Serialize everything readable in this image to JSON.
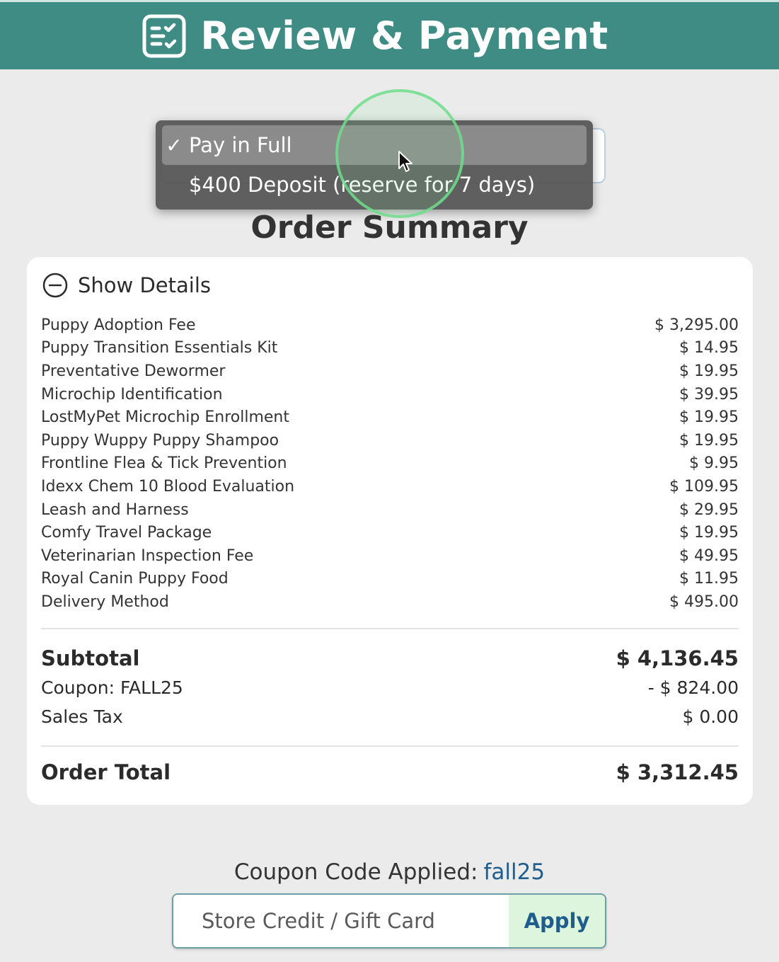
{
  "header": {
    "title": "Review & Payment",
    "icon": "checklist-icon"
  },
  "payment_dropdown": {
    "options": [
      {
        "label": "Pay in Full",
        "selected": true
      },
      {
        "label": "$400 Deposit (reserve for 7 days)",
        "selected": false
      }
    ],
    "check_mark": "✓"
  },
  "summary": {
    "title": "Order Summary",
    "toggle_label": "Show Details",
    "items": [
      {
        "name": "Puppy Adoption Fee",
        "price": "$ 3,295.00"
      },
      {
        "name": "Puppy Transition Essentials Kit",
        "price": "$ 14.95"
      },
      {
        "name": "Preventative Dewormer",
        "price": "$ 19.95"
      },
      {
        "name": "Microchip Identification",
        "price": "$ 39.95"
      },
      {
        "name": "LostMyPet Microchip Enrollment",
        "price": "$ 19.95"
      },
      {
        "name": "Puppy Wuppy Puppy Shampoo",
        "price": "$ 19.95"
      },
      {
        "name": "Frontline Flea & Tick Prevention",
        "price": "$ 9.95"
      },
      {
        "name": "Idexx Chem 10 Blood Evaluation",
        "price": "$ 109.95"
      },
      {
        "name": "Leash and Harness",
        "price": "$ 29.95"
      },
      {
        "name": "Comfy Travel Package",
        "price": "$ 19.95"
      },
      {
        "name": "Veterinarian Inspection Fee",
        "price": "$ 49.95"
      },
      {
        "name": "Royal Canin Puppy Food",
        "price": "$ 11.95"
      },
      {
        "name": "Delivery Method",
        "price": "$ 495.00"
      }
    ],
    "subtotal_label": "Subtotal",
    "subtotal_value": "$ 4,136.45",
    "coupon_label": "Coupon: FALL25",
    "coupon_value": "- $ 824.00",
    "tax_label": "Sales Tax",
    "tax_value": "$ 0.00",
    "total_label": "Order Total",
    "total_value": "$ 3,312.45"
  },
  "coupon": {
    "applied_label": "Coupon Code Applied:",
    "code": "fall25"
  },
  "store_credit": {
    "placeholder": "Store Credit / Gift Card",
    "apply_label": "Apply"
  },
  "colors": {
    "header_bg": "#3e8c84",
    "page_bg": "#ebebeb",
    "link_blue": "#1f5d8c",
    "apply_bg": "#dcf5dc"
  }
}
